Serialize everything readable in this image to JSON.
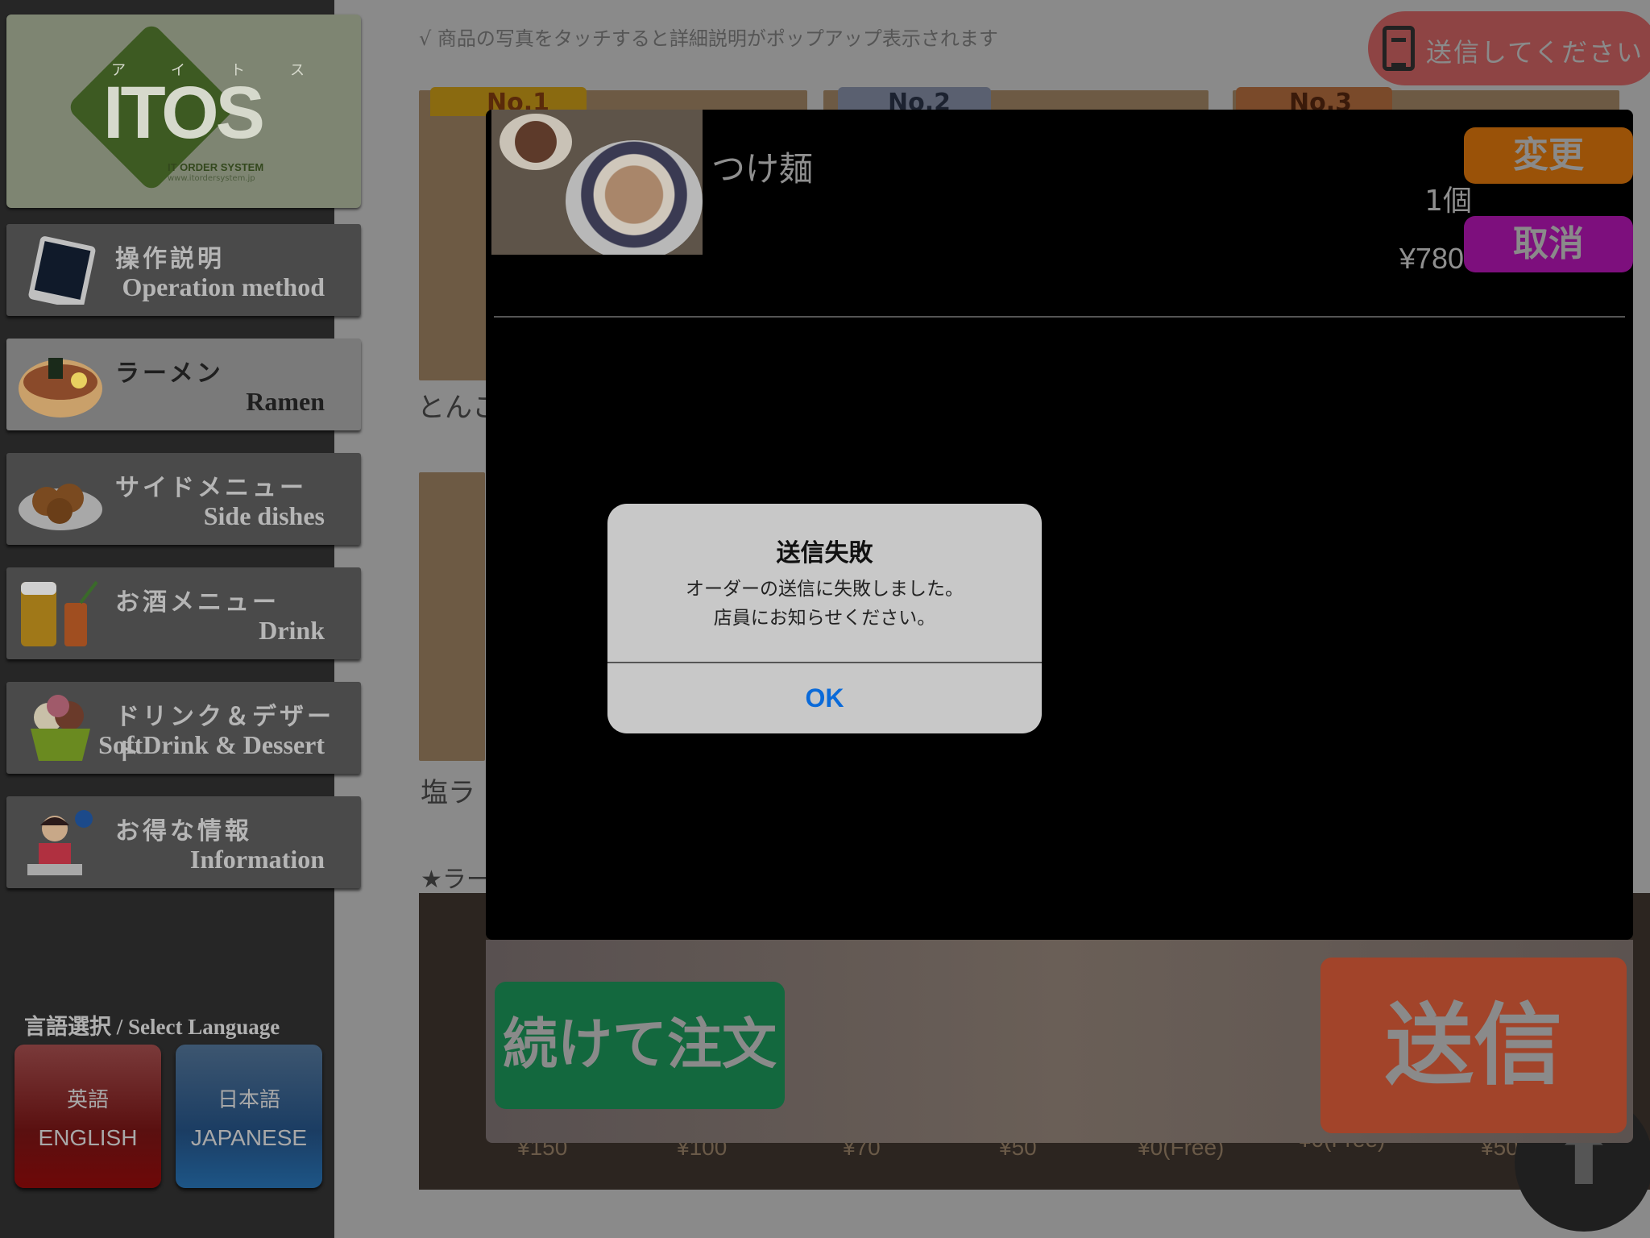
{
  "logo": {
    "kana": [
      "ア",
      "イ",
      "ト",
      "ス"
    ],
    "text": "ITOS",
    "sub": "IT ORDER SYSTEM",
    "url": "www.itordersystem.jp"
  },
  "sidebar": {
    "items": [
      {
        "ja": "操作説明",
        "en": "Operation method"
      },
      {
        "ja": "ラーメン",
        "en": "Ramen"
      },
      {
        "ja": "サイドメニュー",
        "en": "Side dishes"
      },
      {
        "ja": "お酒メニュー",
        "en": "Drink"
      },
      {
        "ja": "ドリンク＆デザート",
        "en": "SoftDrink & Dessert"
      },
      {
        "ja": "お得な情報",
        "en": "Information"
      }
    ],
    "language_label": "言語選択 / Select Language",
    "lang_en": {
      "ja": "英語",
      "en": "ENGLISH"
    },
    "lang_ja": {
      "ja": "日本語",
      "en": "JAPANESE"
    }
  },
  "header": {
    "hint": "√ 商品の写真をタッチすると詳細説明がポップアップ表示されます",
    "send_pill": "送信してください"
  },
  "background": {
    "badges": [
      "No.1",
      "No.2",
      "No.3"
    ],
    "items": [
      "とんこ",
      "塩ラ",
      "★ラー"
    ],
    "prices": [
      "¥150",
      "¥100",
      "¥70",
      "¥50",
      "¥0(Free)",
      "¥0(Free)",
      "¥50"
    ],
    "scroll_up": "⬆"
  },
  "order": {
    "name": "つけ麺",
    "qty": "1個",
    "price": "¥780",
    "change": "変更",
    "cancel": "取消",
    "continue": "続けて注文",
    "send": "送信"
  },
  "alert": {
    "title": "送信失敗",
    "line1": "オーダーの送信に失敗しました。",
    "line2": "店員にお知らせください。",
    "ok": "OK"
  },
  "colors": {
    "change": "#df7a0e",
    "cancel": "#b31ab3",
    "continue": "#1a9a5a",
    "send": "#e2633f",
    "ok": "#0a7aff"
  }
}
